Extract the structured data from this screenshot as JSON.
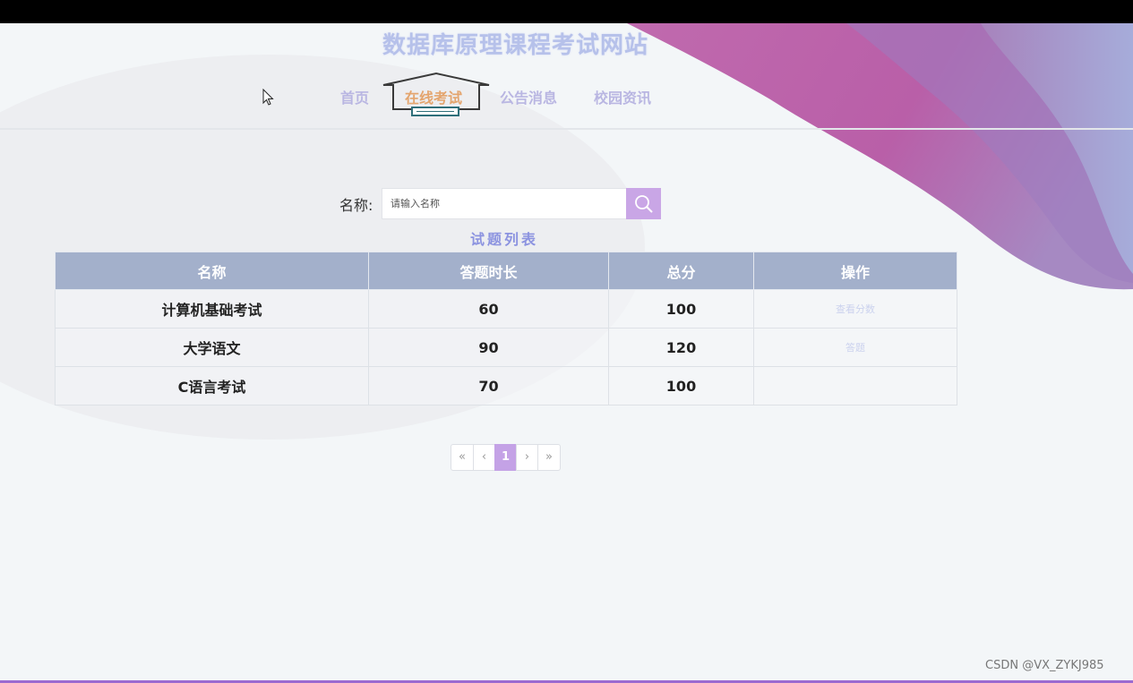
{
  "site": {
    "title": "数据库原理课程考试网站"
  },
  "nav": {
    "items": [
      {
        "label": "首页"
      },
      {
        "label": "在线考试"
      },
      {
        "label": "公告消息"
      },
      {
        "label": "校园资讯"
      }
    ],
    "active_index": 1
  },
  "search": {
    "label": "名称:",
    "placeholder": "请输入名称",
    "button_icon": "search-icon"
  },
  "list": {
    "title": "试题列表",
    "columns": [
      "名称",
      "答题时长",
      "总分",
      "操作"
    ],
    "rows": [
      {
        "name": "计算机基础考试",
        "duration": "60",
        "score": "100",
        "action": "查看分数"
      },
      {
        "name": "大学语文",
        "duration": "90",
        "score": "120",
        "action": "答题"
      },
      {
        "name": "C语言考试",
        "duration": "70",
        "score": "100",
        "action": ""
      }
    ]
  },
  "pagination": {
    "first": "«",
    "prev": "‹",
    "current": "1",
    "next": "›",
    "last": "»"
  },
  "watermark": "CSDN @VX_ZYKJ985",
  "colors": {
    "accent": "#c9a6e6",
    "table_header": "#a3b0cb",
    "nav_text": "#b9b6e2",
    "nav_active": "#e4a56e",
    "title": "#b6c1ea"
  }
}
